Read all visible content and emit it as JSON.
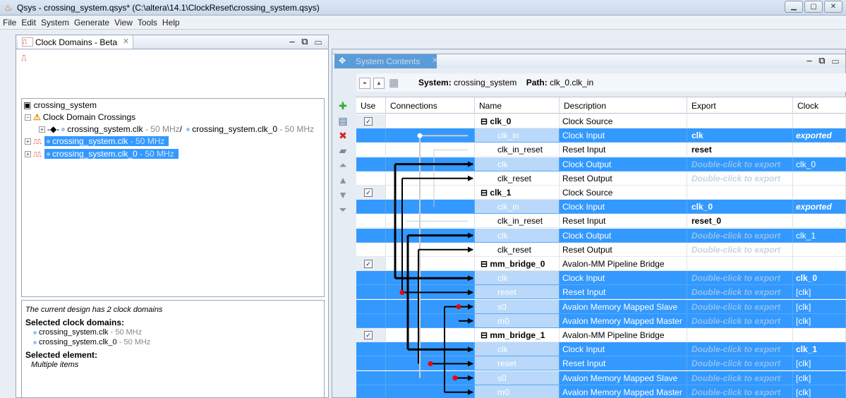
{
  "window": {
    "title": "Qsys - crossing_system.qsys* (C:\\altera\\14.1\\ClockReset\\crossing_system.qsys)",
    "buttons": [
      "minimize",
      "maximize",
      "close"
    ]
  },
  "menu": [
    "File",
    "Edit",
    "System",
    "Generate",
    "View",
    "Tools",
    "Help"
  ],
  "left_tab": {
    "label": "Clock Domains - Beta"
  },
  "tree": {
    "root": "crossing_system",
    "crossings": "Clock Domain Crossings",
    "crossing_from": "crossing_system.clk",
    "crossing_from_freq": " - 50 MHz",
    "crossing_sep": "/ ",
    "crossing_to": "crossing_system.clk_0",
    "crossing_to_freq": " - 50 MHz",
    "domain1": "crossing_system.clk",
    "domain1_freq": " - 50 MHz",
    "domain2": "crossing_system.clk_0",
    "domain2_freq": " - 50 MHz"
  },
  "info": {
    "summary": "The current design has 2 clock domains",
    "selected_domains_label": "Selected clock domains:",
    "domain_a": "crossing_system.clk",
    "domain_a_freq": " - 50 MHz",
    "domain_b": "crossing_system.clk_0",
    "domain_b_freq": " - 50 MHz",
    "selected_element_label": "Selected element:",
    "selected_element_value": "Multiple items"
  },
  "right_tab": {
    "label": "System Contents"
  },
  "path": {
    "system_label": "System:",
    "system": "crossing_system",
    "path_label": "Path:",
    "path": "clk_0.clk_in"
  },
  "columns": {
    "use": "Use",
    "connections": "Connections",
    "name": "Name",
    "description": "Description",
    "export": "Export",
    "clock": "Clock"
  },
  "rows": [
    {
      "name": "clk_0",
      "desc": "Clock Source",
      "export": "",
      "clock": "",
      "type": "comp",
      "sel": false
    },
    {
      "name": "clk_in",
      "desc": "Clock Input",
      "export": "clk",
      "clock": "exported",
      "type": "port",
      "sel": true,
      "exported": true
    },
    {
      "name": "clk_in_reset",
      "desc": "Reset Input",
      "export": "reset",
      "clock": "",
      "type": "port",
      "sel": false,
      "exported": true
    },
    {
      "name": "clk",
      "desc": "Clock Output",
      "export": "Double-click to export",
      "clock": "clk_0",
      "type": "port",
      "sel": true
    },
    {
      "name": "clk_reset",
      "desc": "Reset Output",
      "export": "Double-click to export",
      "clock": "",
      "type": "port",
      "sel": false
    },
    {
      "name": "clk_1",
      "desc": "Clock Source",
      "export": "",
      "clock": "",
      "type": "comp",
      "sel": false
    },
    {
      "name": "clk_in",
      "desc": "Clock Input",
      "export": "clk_0",
      "clock": "exported",
      "type": "port",
      "sel": true,
      "exported": true
    },
    {
      "name": "clk_in_reset",
      "desc": "Reset Input",
      "export": "reset_0",
      "clock": "",
      "type": "port",
      "sel": false,
      "exported": true
    },
    {
      "name": "clk",
      "desc": "Clock Output",
      "export": "Double-click to export",
      "clock": "clk_1",
      "type": "port",
      "sel": true
    },
    {
      "name": "clk_reset",
      "desc": "Reset Output",
      "export": "Double-click to export",
      "clock": "",
      "type": "port",
      "sel": false
    },
    {
      "name": "mm_bridge_0",
      "desc": "Avalon-MM Pipeline Bridge",
      "export": "",
      "clock": "",
      "type": "comp",
      "sel": false
    },
    {
      "name": "clk",
      "desc": "Clock Input",
      "export": "Double-click to export",
      "clock": "clk_0",
      "type": "port",
      "sel": true,
      "boldclock": true
    },
    {
      "name": "reset",
      "desc": "Reset Input",
      "export": "Double-click to export",
      "clock": "[clk]",
      "type": "port",
      "sel": true
    },
    {
      "name": "s0",
      "desc": "Avalon Memory Mapped Slave",
      "export": "Double-click to export",
      "clock": "[clk]",
      "type": "port",
      "sel": true
    },
    {
      "name": "m0",
      "desc": "Avalon Memory Mapped Master",
      "export": "Double-click to export",
      "clock": "[clk]",
      "type": "port",
      "sel": true
    },
    {
      "name": "mm_bridge_1",
      "desc": "Avalon-MM Pipeline Bridge",
      "export": "",
      "clock": "",
      "type": "comp",
      "sel": false
    },
    {
      "name": "clk",
      "desc": "Clock Input",
      "export": "Double-click to export",
      "clock": "clk_1",
      "type": "port",
      "sel": true,
      "boldclock": true
    },
    {
      "name": "reset",
      "desc": "Reset Input",
      "export": "Double-click to export",
      "clock": "[clk]",
      "type": "port",
      "sel": true
    },
    {
      "name": "s0",
      "desc": "Avalon Memory Mapped Slave",
      "export": "Double-click to export",
      "clock": "[clk]",
      "type": "port",
      "sel": true
    },
    {
      "name": "m0",
      "desc": "Avalon Memory Mapped Master",
      "export": "Double-click to export",
      "clock": "[clk]",
      "type": "port",
      "sel": true
    }
  ],
  "colors": {
    "selection": "#3399ff",
    "selection_light": "#cfe4ff"
  }
}
